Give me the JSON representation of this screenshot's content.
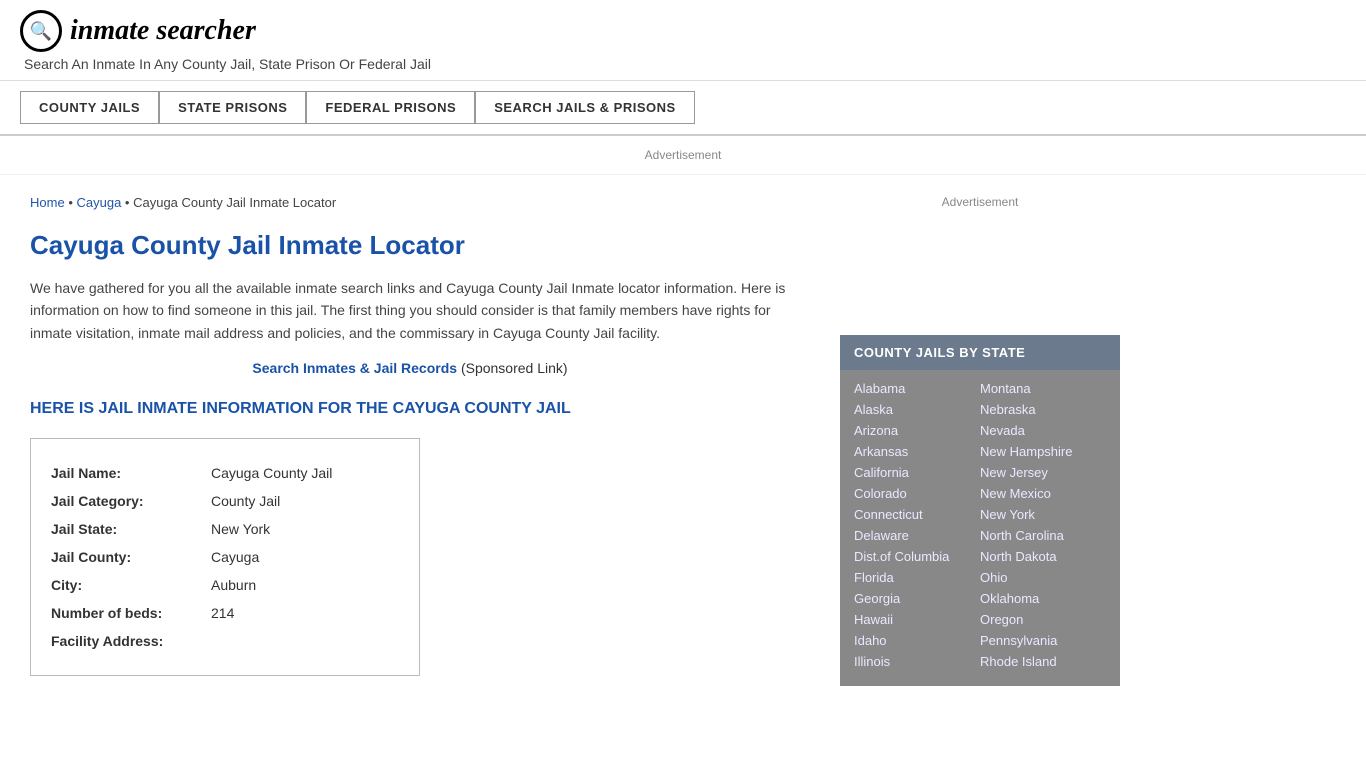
{
  "header": {
    "logo_icon": "🔍",
    "logo_text": "inmate searcher",
    "tagline": "Search An Inmate In Any County Jail, State Prison Or Federal Jail"
  },
  "nav": {
    "items": [
      {
        "id": "county-jails",
        "label": "COUNTY JAILS"
      },
      {
        "id": "state-prisons",
        "label": "STATE PRISONS"
      },
      {
        "id": "federal-prisons",
        "label": "FEDERAL PRISONS"
      },
      {
        "id": "search-jails",
        "label": "SEARCH JAILS & PRISONS"
      }
    ]
  },
  "ad_top": "Advertisement",
  "breadcrumb": {
    "home": "Home",
    "cayuga": "Cayuga",
    "current": "Cayuga County Jail Inmate Locator"
  },
  "page_title": "Cayuga County Jail Inmate Locator",
  "description": "We have gathered for you all the available inmate search links and Cayuga County Jail Inmate locator information. Here is information on how to find someone in this jail. The first thing you should consider is that family members have rights for inmate visitation, inmate mail address and policies, and the commissary in Cayuga County Jail facility.",
  "sponsored": {
    "link_text": "Search Inmates & Jail Records",
    "note": "(Sponsored Link)"
  },
  "section_heading": "HERE IS JAIL INMATE INFORMATION FOR THE CAYUGA COUNTY JAIL",
  "info_box": {
    "fields": [
      {
        "label": "Jail Name:",
        "value": "Cayuga County Jail"
      },
      {
        "label": "Jail Category:",
        "value": "County Jail"
      },
      {
        "label": "Jail State:",
        "value": "New York"
      },
      {
        "label": "Jail County:",
        "value": "Cayuga"
      },
      {
        "label": "City:",
        "value": "Auburn"
      },
      {
        "label": "Number of beds:",
        "value": "214"
      },
      {
        "label": "Facility Address:",
        "value": ""
      }
    ]
  },
  "ad_sidebar": "Advertisement",
  "state_box": {
    "title": "COUNTY JAILS BY STATE",
    "left_col": [
      "Alabama",
      "Alaska",
      "Arizona",
      "Arkansas",
      "California",
      "Colorado",
      "Connecticut",
      "Delaware",
      "Dist.of Columbia",
      "Florida",
      "Georgia",
      "Hawaii",
      "Idaho",
      "Illinois"
    ],
    "right_col": [
      "Montana",
      "Nebraska",
      "Nevada",
      "New Hampshire",
      "New Jersey",
      "New Mexico",
      "New York",
      "North Carolina",
      "North Dakota",
      "Ohio",
      "Oklahoma",
      "Oregon",
      "Pennsylvania",
      "Rhode Island"
    ]
  }
}
